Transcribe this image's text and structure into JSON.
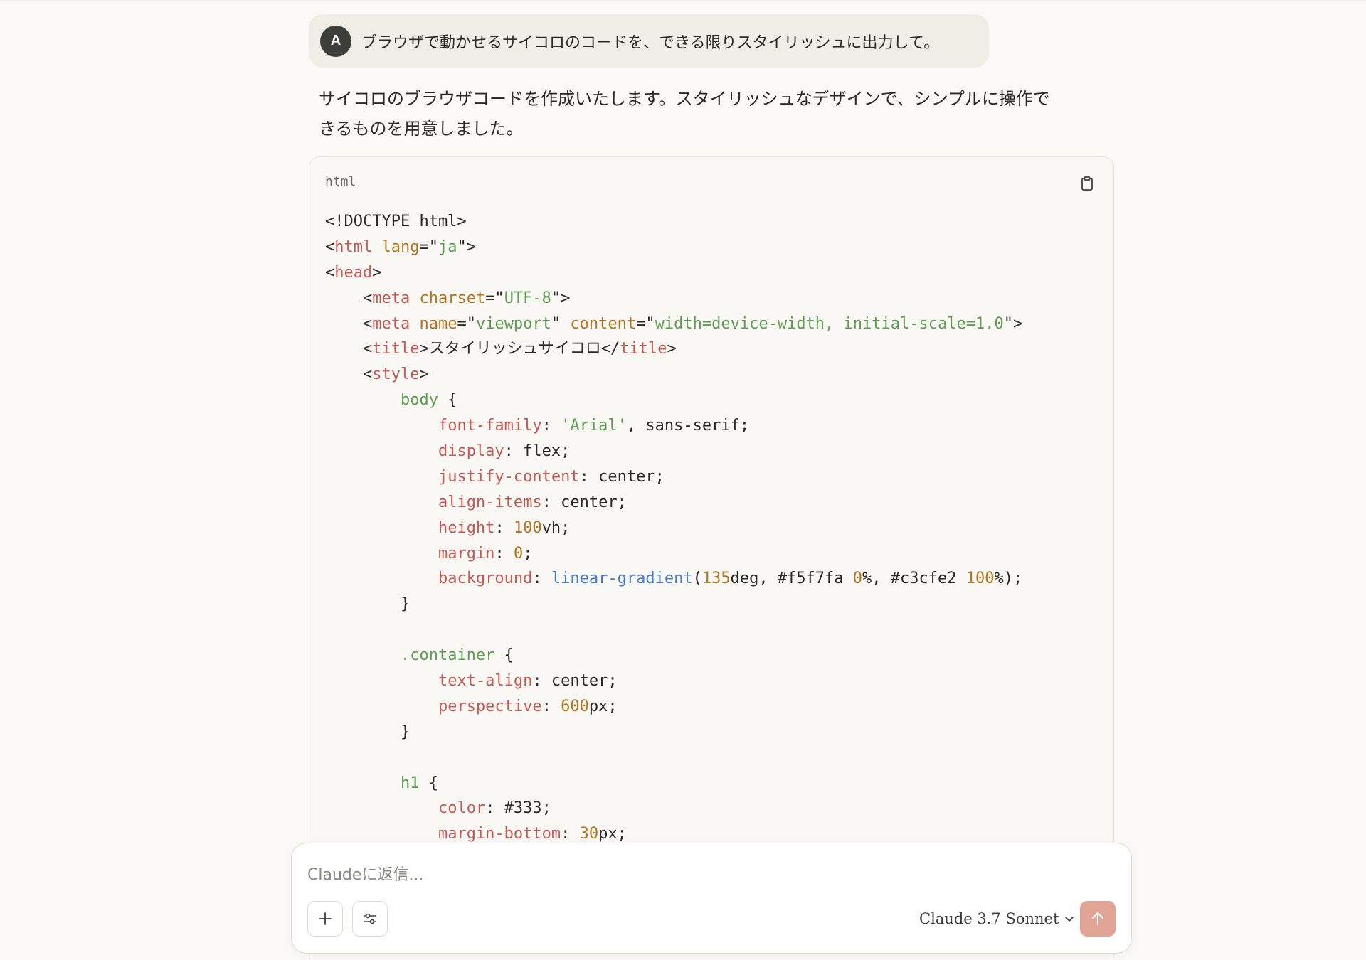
{
  "user_message": {
    "avatar_initial": "A",
    "text": "ブラウザで動かせるサイコロのコードを、できる限りスタイリッシュに出力して。"
  },
  "assistant": {
    "text_line1": "サイコロのブラウザコードを作成いたします。スタイリッシュなデザインで、シンプルに操作で",
    "text_line2": "きるものを用意しました。"
  },
  "code_block": {
    "language": "html",
    "copy_icon": "clipboard-icon",
    "lines": [
      [
        [
          "plain",
          "<!DOCTYPE html>"
        ]
      ],
      [
        [
          "plain",
          "<"
        ],
        [
          "tag",
          "html"
        ],
        [
          "plain",
          " "
        ],
        [
          "attr",
          "lang"
        ],
        [
          "plain",
          "=\""
        ],
        [
          "str",
          "ja"
        ],
        [
          "plain",
          "\">"
        ]
      ],
      [
        [
          "plain",
          "<"
        ],
        [
          "tag",
          "head"
        ],
        [
          "plain",
          ">"
        ]
      ],
      [
        [
          "plain",
          "    <"
        ],
        [
          "tag",
          "meta"
        ],
        [
          "plain",
          " "
        ],
        [
          "attr",
          "charset"
        ],
        [
          "plain",
          "=\""
        ],
        [
          "str",
          "UTF-8"
        ],
        [
          "plain",
          "\">"
        ]
      ],
      [
        [
          "plain",
          "    <"
        ],
        [
          "tag",
          "meta"
        ],
        [
          "plain",
          " "
        ],
        [
          "attr",
          "name"
        ],
        [
          "plain",
          "=\""
        ],
        [
          "str",
          "viewport"
        ],
        [
          "plain",
          "\" "
        ],
        [
          "attr",
          "content"
        ],
        [
          "plain",
          "=\""
        ],
        [
          "str",
          "width=device-width, initial-scale=1.0"
        ],
        [
          "plain",
          "\">"
        ]
      ],
      [
        [
          "plain",
          "    <"
        ],
        [
          "tag",
          "title"
        ],
        [
          "plain",
          ">スタイリッシュサイコロ</"
        ],
        [
          "tag",
          "title"
        ],
        [
          "plain",
          ">"
        ]
      ],
      [
        [
          "plain",
          "    <"
        ],
        [
          "tag",
          "style"
        ],
        [
          "plain",
          ">"
        ]
      ],
      [
        [
          "plain",
          "        "
        ],
        [
          "sel",
          "body"
        ],
        [
          "plain",
          " {"
        ]
      ],
      [
        [
          "plain",
          "            "
        ],
        [
          "prop",
          "font-family"
        ],
        [
          "plain",
          ": "
        ],
        [
          "str",
          "'Arial'"
        ],
        [
          "plain",
          ", sans-serif;"
        ]
      ],
      [
        [
          "plain",
          "            "
        ],
        [
          "prop",
          "display"
        ],
        [
          "plain",
          ": flex;"
        ]
      ],
      [
        [
          "plain",
          "            "
        ],
        [
          "prop",
          "justify-content"
        ],
        [
          "plain",
          ": center;"
        ]
      ],
      [
        [
          "plain",
          "            "
        ],
        [
          "prop",
          "align-items"
        ],
        [
          "plain",
          ": center;"
        ]
      ],
      [
        [
          "plain",
          "            "
        ],
        [
          "prop",
          "height"
        ],
        [
          "plain",
          ": "
        ],
        [
          "num",
          "100"
        ],
        [
          "plain",
          "vh;"
        ]
      ],
      [
        [
          "plain",
          "            "
        ],
        [
          "prop",
          "margin"
        ],
        [
          "plain",
          ": "
        ],
        [
          "num",
          "0"
        ],
        [
          "plain",
          ";"
        ]
      ],
      [
        [
          "plain",
          "            "
        ],
        [
          "prop",
          "background"
        ],
        [
          "plain",
          ": "
        ],
        [
          "fn",
          "linear-gradient"
        ],
        [
          "plain",
          "("
        ],
        [
          "num",
          "135"
        ],
        [
          "plain",
          "deg, #f5f7fa "
        ],
        [
          "num",
          "0"
        ],
        [
          "plain",
          "%, #c3cfe2 "
        ],
        [
          "num",
          "100"
        ],
        [
          "plain",
          "%);"
        ]
      ],
      [
        [
          "plain",
          "        }"
        ]
      ],
      [
        [
          "plain",
          ""
        ]
      ],
      [
        [
          "plain",
          "        "
        ],
        [
          "sel",
          ".container"
        ],
        [
          "plain",
          " {"
        ]
      ],
      [
        [
          "plain",
          "            "
        ],
        [
          "prop",
          "text-align"
        ],
        [
          "plain",
          ": center;"
        ]
      ],
      [
        [
          "plain",
          "            "
        ],
        [
          "prop",
          "perspective"
        ],
        [
          "plain",
          ": "
        ],
        [
          "num",
          "600"
        ],
        [
          "plain",
          "px;"
        ]
      ],
      [
        [
          "plain",
          "        }"
        ]
      ],
      [
        [
          "plain",
          ""
        ]
      ],
      [
        [
          "plain",
          "        "
        ],
        [
          "sel",
          "h1"
        ],
        [
          "plain",
          " {"
        ]
      ],
      [
        [
          "plain",
          "            "
        ],
        [
          "prop",
          "color"
        ],
        [
          "plain",
          ": #333;"
        ]
      ],
      [
        [
          "plain",
          "            "
        ],
        [
          "prop",
          "margin-bottom"
        ],
        [
          "plain",
          ": "
        ],
        [
          "num",
          "30"
        ],
        [
          "plain",
          "px;"
        ]
      ]
    ]
  },
  "composer": {
    "placeholder": "Claudeに返信...",
    "add_icon": "plus-icon",
    "tools_icon": "sliders-icon",
    "model_label": "Claude 3.7 Sonnet",
    "model_icon": "chevron-down-icon",
    "send_icon": "arrow-up-icon"
  },
  "colors": {
    "background": "#faf9f6",
    "tag": "#c65a54",
    "attribute": "#b5761f",
    "string": "#5f9e52",
    "function": "#4a7ad0",
    "send_button": "#e0a594"
  }
}
